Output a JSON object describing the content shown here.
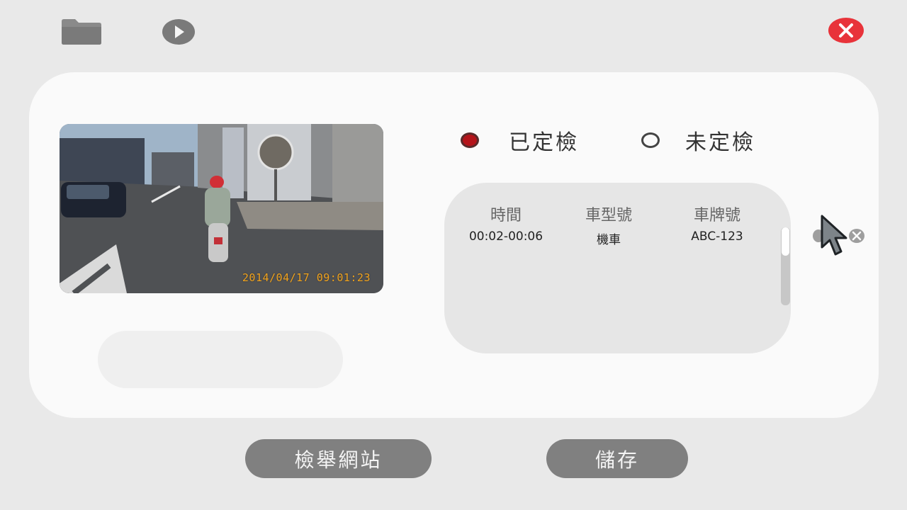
{
  "toolbar": {
    "folder_icon": "folder-icon",
    "play_icon": "play-icon",
    "close_icon": "close-icon",
    "close_color": "#e8333a"
  },
  "video": {
    "timestamp": "2014/04/17  09:01:23"
  },
  "filter": {
    "input_value": "",
    "options": [
      {
        "label": "已定檢",
        "selected": true
      },
      {
        "label": "未定檢",
        "selected": false
      }
    ],
    "selected_color": "#b4141a"
  },
  "results": {
    "columns": [
      "時間",
      "車型號",
      "車牌號"
    ],
    "rows": [
      {
        "time": "00:02-00:06",
        "type": "機車",
        "plate": "ABC-123"
      }
    ]
  },
  "actions": {
    "report_label": "檢舉網站",
    "save_label": "儲存"
  }
}
